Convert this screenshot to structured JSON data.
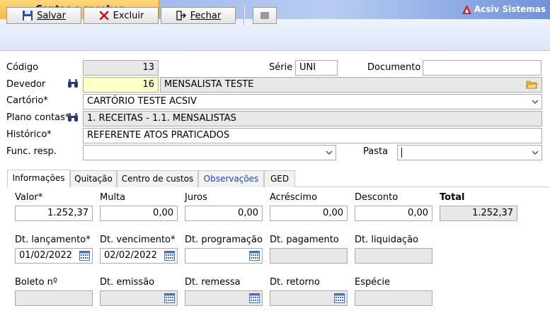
{
  "window": {
    "title": "Contas a receber",
    "brand": "Acsiv Sistemas"
  },
  "toolbar": {
    "save_label": "Salvar",
    "delete_label": "Excluir",
    "close_label": "Fechar"
  },
  "form": {
    "codigo": {
      "label": "Código",
      "value": "13"
    },
    "serie": {
      "label": "Série",
      "value": "UNI"
    },
    "documento": {
      "label": "Documento",
      "value": ""
    },
    "devedor": {
      "label": "Devedor",
      "code": "16",
      "name": "MENSALISTA TESTE"
    },
    "cartorio": {
      "label": "Cartório*",
      "value": "CARTÓRIO TESTE ACSIV"
    },
    "plano": {
      "label": "Plano contas*",
      "value": "1. RECEITAS - 1.1. MENSALISTAS"
    },
    "historico": {
      "label": "Histórico*",
      "value": "REFERENTE ATOS PRATICADOS"
    },
    "func": {
      "label": "Func. resp.",
      "value": ""
    },
    "pasta": {
      "label": "Pasta",
      "value": ""
    }
  },
  "tabs": [
    "Informações",
    "Quitação",
    "Centro de custos",
    "Observações",
    "GED"
  ],
  "info": {
    "valor": {
      "label": "Valor*",
      "value": "1.252,37"
    },
    "multa": {
      "label": "Multa",
      "value": "0,00"
    },
    "juros": {
      "label": "Juros",
      "value": "0,00"
    },
    "acrescimo": {
      "label": "Acréscimo",
      "value": "0,00"
    },
    "desconto": {
      "label": "Desconto",
      "value": "0,00"
    },
    "total": {
      "label": "Total",
      "value": "1.252,37"
    },
    "dt_lancamento": {
      "label": "Dt. lançamento*",
      "value": "01/02/2022"
    },
    "dt_vencimento": {
      "label": "Dt. vencimento*",
      "value": "02/02/2022"
    },
    "dt_programacao": {
      "label": "Dt. programação",
      "value": ""
    },
    "dt_pagamento": {
      "label": "Dt. pagamento",
      "value": ""
    },
    "dt_liquidacao": {
      "label": "Dt. liquidação",
      "value": ""
    },
    "boleto": {
      "label": "Boleto nº",
      "value": ""
    },
    "dt_emissao": {
      "label": "Dt. emissão",
      "value": ""
    },
    "dt_remessa": {
      "label": "Dt. remessa",
      "value": ""
    },
    "dt_retorno": {
      "label": "Dt. retorno",
      "value": ""
    },
    "especie": {
      "label": "Espécie",
      "value": ""
    }
  },
  "colors": {
    "title_tab": "#f6b94a",
    "title_bar": "#8aa9e6",
    "toolbar_bg": "#dbe6f8",
    "readonly_bg": "#e8e8e8",
    "highlight_bg": "#ffffc8",
    "link_tab": "#1a47b8"
  },
  "icons": [
    "save-icon",
    "delete-icon",
    "exit-icon",
    "binoculars-icon",
    "folder-icon",
    "calendar-icon",
    "chevron-down-icon",
    "brand-logo-icon"
  ]
}
